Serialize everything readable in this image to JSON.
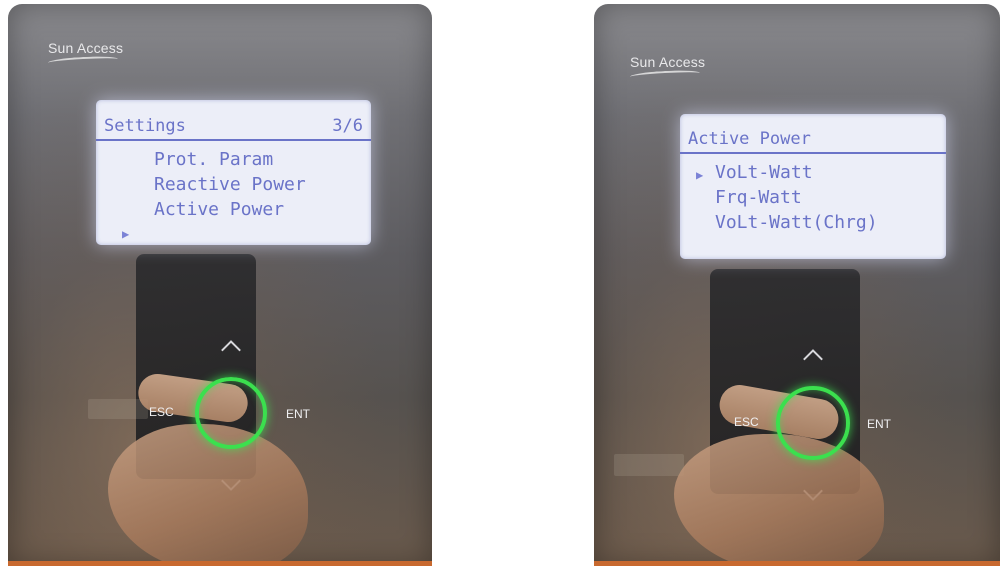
{
  "photos": [
    {
      "brand": "Sun Access",
      "lcd": {
        "title": "Settings",
        "page": "3/6",
        "items": [
          "Prot. Param",
          "Reactive Power",
          "Active Power"
        ],
        "selected_index": 2
      },
      "keys": {
        "esc": "ESC",
        "ent": "ENT"
      }
    },
    {
      "brand": "Sun Access",
      "lcd": {
        "title": "Active Power",
        "page": "",
        "items": [
          "VoLt-Watt",
          "Frq-Watt",
          "VoLt-Watt(Chrg)"
        ],
        "selected_index": 0
      },
      "keys": {
        "esc": "ESC",
        "ent": "ENT"
      }
    }
  ],
  "colors": {
    "lcd_text": "#6a73c8",
    "lcd_bg": "#eceef8",
    "ring": "#3be04e",
    "accent_strip": "#c8692f"
  },
  "icons": {
    "cursor": "triangle-right-icon",
    "up": "chevron-up-icon",
    "down": "chevron-down-icon"
  }
}
